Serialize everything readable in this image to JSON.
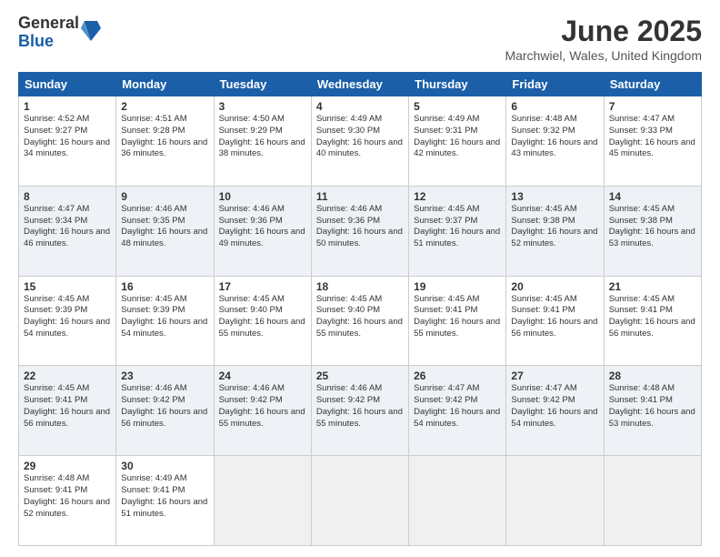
{
  "logo": {
    "general": "General",
    "blue": "Blue"
  },
  "title": "June 2025",
  "location": "Marchwiel, Wales, United Kingdom",
  "headers": [
    "Sunday",
    "Monday",
    "Tuesday",
    "Wednesday",
    "Thursday",
    "Friday",
    "Saturday"
  ],
  "rows": [
    [
      {
        "day": "1",
        "sunrise": "Sunrise: 4:52 AM",
        "sunset": "Sunset: 9:27 PM",
        "daylight": "Daylight: 16 hours and 34 minutes."
      },
      {
        "day": "2",
        "sunrise": "Sunrise: 4:51 AM",
        "sunset": "Sunset: 9:28 PM",
        "daylight": "Daylight: 16 hours and 36 minutes."
      },
      {
        "day": "3",
        "sunrise": "Sunrise: 4:50 AM",
        "sunset": "Sunset: 9:29 PM",
        "daylight": "Daylight: 16 hours and 38 minutes."
      },
      {
        "day": "4",
        "sunrise": "Sunrise: 4:49 AM",
        "sunset": "Sunset: 9:30 PM",
        "daylight": "Daylight: 16 hours and 40 minutes."
      },
      {
        "day": "5",
        "sunrise": "Sunrise: 4:49 AM",
        "sunset": "Sunset: 9:31 PM",
        "daylight": "Daylight: 16 hours and 42 minutes."
      },
      {
        "day": "6",
        "sunrise": "Sunrise: 4:48 AM",
        "sunset": "Sunset: 9:32 PM",
        "daylight": "Daylight: 16 hours and 43 minutes."
      },
      {
        "day": "7",
        "sunrise": "Sunrise: 4:47 AM",
        "sunset": "Sunset: 9:33 PM",
        "daylight": "Daylight: 16 hours and 45 minutes."
      }
    ],
    [
      {
        "day": "8",
        "sunrise": "Sunrise: 4:47 AM",
        "sunset": "Sunset: 9:34 PM",
        "daylight": "Daylight: 16 hours and 46 minutes."
      },
      {
        "day": "9",
        "sunrise": "Sunrise: 4:46 AM",
        "sunset": "Sunset: 9:35 PM",
        "daylight": "Daylight: 16 hours and 48 minutes."
      },
      {
        "day": "10",
        "sunrise": "Sunrise: 4:46 AM",
        "sunset": "Sunset: 9:36 PM",
        "daylight": "Daylight: 16 hours and 49 minutes."
      },
      {
        "day": "11",
        "sunrise": "Sunrise: 4:46 AM",
        "sunset": "Sunset: 9:36 PM",
        "daylight": "Daylight: 16 hours and 50 minutes."
      },
      {
        "day": "12",
        "sunrise": "Sunrise: 4:45 AM",
        "sunset": "Sunset: 9:37 PM",
        "daylight": "Daylight: 16 hours and 51 minutes."
      },
      {
        "day": "13",
        "sunrise": "Sunrise: 4:45 AM",
        "sunset": "Sunset: 9:38 PM",
        "daylight": "Daylight: 16 hours and 52 minutes."
      },
      {
        "day": "14",
        "sunrise": "Sunrise: 4:45 AM",
        "sunset": "Sunset: 9:38 PM",
        "daylight": "Daylight: 16 hours and 53 minutes."
      }
    ],
    [
      {
        "day": "15",
        "sunrise": "Sunrise: 4:45 AM",
        "sunset": "Sunset: 9:39 PM",
        "daylight": "Daylight: 16 hours and 54 minutes."
      },
      {
        "day": "16",
        "sunrise": "Sunrise: 4:45 AM",
        "sunset": "Sunset: 9:39 PM",
        "daylight": "Daylight: 16 hours and 54 minutes."
      },
      {
        "day": "17",
        "sunrise": "Sunrise: 4:45 AM",
        "sunset": "Sunset: 9:40 PM",
        "daylight": "Daylight: 16 hours and 55 minutes."
      },
      {
        "day": "18",
        "sunrise": "Sunrise: 4:45 AM",
        "sunset": "Sunset: 9:40 PM",
        "daylight": "Daylight: 16 hours and 55 minutes."
      },
      {
        "day": "19",
        "sunrise": "Sunrise: 4:45 AM",
        "sunset": "Sunset: 9:41 PM",
        "daylight": "Daylight: 16 hours and 55 minutes."
      },
      {
        "day": "20",
        "sunrise": "Sunrise: 4:45 AM",
        "sunset": "Sunset: 9:41 PM",
        "daylight": "Daylight: 16 hours and 56 minutes."
      },
      {
        "day": "21",
        "sunrise": "Sunrise: 4:45 AM",
        "sunset": "Sunset: 9:41 PM",
        "daylight": "Daylight: 16 hours and 56 minutes."
      }
    ],
    [
      {
        "day": "22",
        "sunrise": "Sunrise: 4:45 AM",
        "sunset": "Sunset: 9:41 PM",
        "daylight": "Daylight: 16 hours and 56 minutes."
      },
      {
        "day": "23",
        "sunrise": "Sunrise: 4:46 AM",
        "sunset": "Sunset: 9:42 PM",
        "daylight": "Daylight: 16 hours and 56 minutes."
      },
      {
        "day": "24",
        "sunrise": "Sunrise: 4:46 AM",
        "sunset": "Sunset: 9:42 PM",
        "daylight": "Daylight: 16 hours and 55 minutes."
      },
      {
        "day": "25",
        "sunrise": "Sunrise: 4:46 AM",
        "sunset": "Sunset: 9:42 PM",
        "daylight": "Daylight: 16 hours and 55 minutes."
      },
      {
        "day": "26",
        "sunrise": "Sunrise: 4:47 AM",
        "sunset": "Sunset: 9:42 PM",
        "daylight": "Daylight: 16 hours and 54 minutes."
      },
      {
        "day": "27",
        "sunrise": "Sunrise: 4:47 AM",
        "sunset": "Sunset: 9:42 PM",
        "daylight": "Daylight: 16 hours and 54 minutes."
      },
      {
        "day": "28",
        "sunrise": "Sunrise: 4:48 AM",
        "sunset": "Sunset: 9:41 PM",
        "daylight": "Daylight: 16 hours and 53 minutes."
      }
    ],
    [
      {
        "day": "29",
        "sunrise": "Sunrise: 4:48 AM",
        "sunset": "Sunset: 9:41 PM",
        "daylight": "Daylight: 16 hours and 52 minutes."
      },
      {
        "day": "30",
        "sunrise": "Sunrise: 4:49 AM",
        "sunset": "Sunset: 9:41 PM",
        "daylight": "Daylight: 16 hours and 51 minutes."
      },
      null,
      null,
      null,
      null,
      null
    ]
  ]
}
